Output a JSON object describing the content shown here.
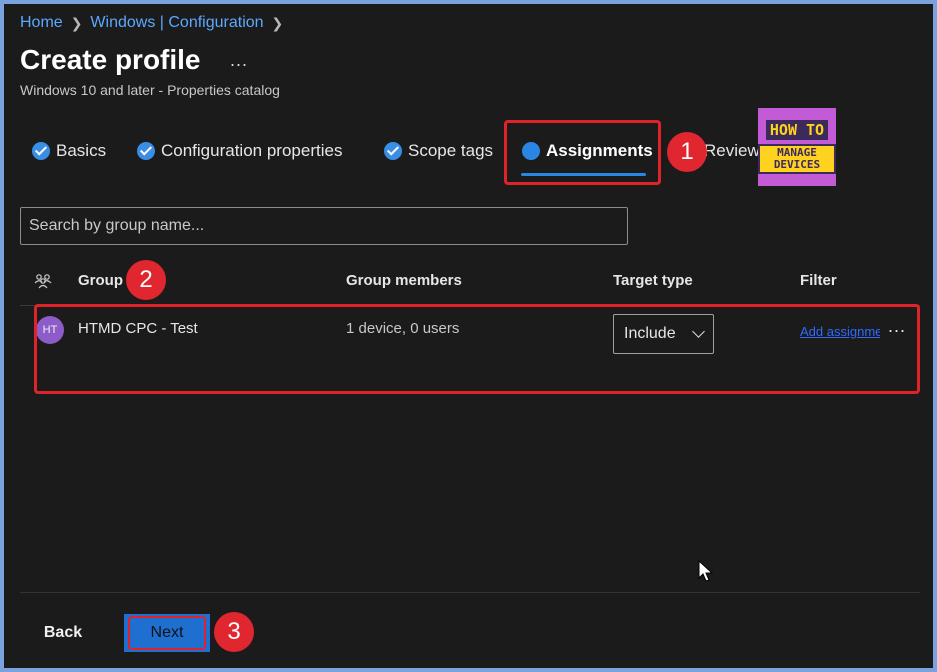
{
  "breadcrumb": [
    "Home",
    "Windows | Configuration"
  ],
  "page": {
    "title": "Create profile",
    "more": "...",
    "subtitle": "Windows 10 and later - Properties catalog"
  },
  "tabs": [
    {
      "label": "Basics",
      "state": "complete"
    },
    {
      "label": "Configuration properties",
      "state": "complete"
    },
    {
      "label": "Scope tags",
      "state": "complete"
    },
    {
      "label": "Assignments",
      "state": "active"
    },
    {
      "label": "Review",
      "state": "pending"
    }
  ],
  "callouts": [
    "1",
    "2",
    "3"
  ],
  "logo": {
    "line1": "HOW TO",
    "line2": "MANAGE DEVICES"
  },
  "search": {
    "placeholder": "Search by group name..."
  },
  "table": {
    "columns": [
      "Group",
      "Group members",
      "Target type",
      "Filter"
    ],
    "rows": [
      {
        "initials": "HT",
        "group": "HTMD CPC - Test",
        "members": "1 device, 0 users",
        "target_type": "Include",
        "filter": "Add assignment filter",
        "more": "..."
      }
    ]
  },
  "footer": {
    "back_label": "Back",
    "next_label": "Next"
  },
  "colors": {
    "accent": "#2b86e3",
    "highlight": "#e0222b",
    "background": "#1b1b1b"
  }
}
